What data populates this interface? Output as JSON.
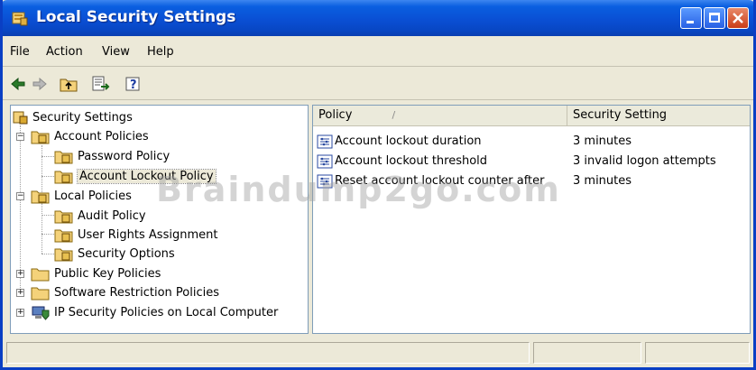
{
  "window": {
    "title": "Local Security Settings"
  },
  "menu": {
    "file": "File",
    "action": "Action",
    "view": "View",
    "help": "Help"
  },
  "toolbar": {
    "back": "back-arrow-icon",
    "forward": "forward-arrow-icon",
    "up": "up-folder-icon",
    "export": "export-list-icon",
    "help": "help-icon"
  },
  "tree": {
    "root": "Security Settings",
    "account_policies": "Account Policies",
    "password_policy": "Password Policy",
    "account_lockout_policy": "Account Lockout Policy",
    "local_policies": "Local Policies",
    "audit_policy": "Audit Policy",
    "user_rights": "User Rights Assignment",
    "security_options": "Security Options",
    "public_key": "Public Key Policies",
    "software_restriction": "Software Restriction Policies",
    "ip_security": "IP Security Policies on Local Computer"
  },
  "list": {
    "col_policy": "Policy",
    "col_setting": "Security Setting",
    "rows": [
      {
        "policy": "Account lockout duration",
        "setting": "3 minutes"
      },
      {
        "policy": "Account lockout threshold",
        "setting": "3 invalid logon attempts"
      },
      {
        "policy": "Reset account lockout counter after",
        "setting": "3 minutes"
      }
    ]
  },
  "watermark": "Braindump2go.com",
  "colors": {
    "titlebar": "#0a4fd4",
    "chrome": "#ece9d8",
    "pane_border": "#7f9db9"
  }
}
